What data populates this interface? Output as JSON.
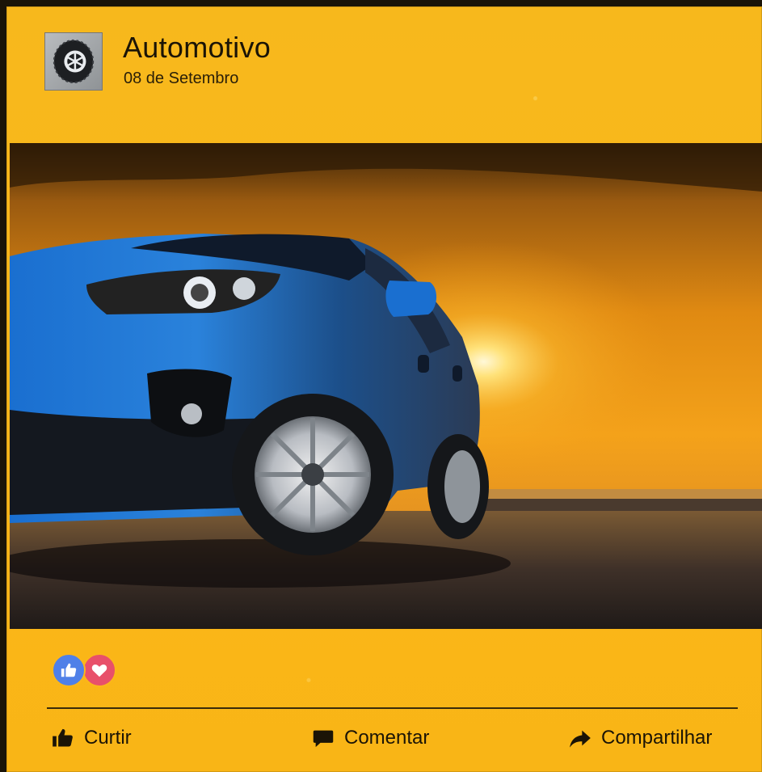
{
  "post": {
    "page_name": "Automotivo",
    "date": "08 de Setembro",
    "avatar_icon": "tire-icon",
    "photo_subject": "blue-suv-at-sunset"
  },
  "reactions": {
    "icons": [
      "like-reaction-icon",
      "love-reaction-icon"
    ],
    "like_color": "#4f80e8",
    "love_color": "#e8506a"
  },
  "actions": {
    "like_label": "Curtir",
    "comment_label": "Comentar",
    "share_label": "Compartilhar"
  },
  "theme": {
    "background": "#fbb71a",
    "text": "#1b1406"
  }
}
